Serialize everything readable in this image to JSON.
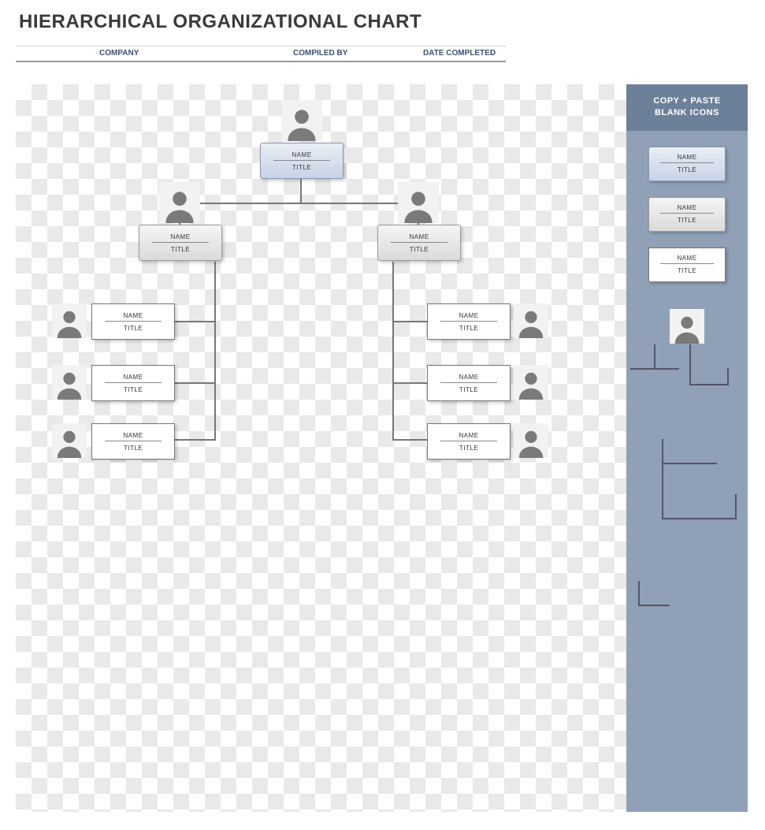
{
  "title": "HIERARCHICAL ORGANIZATIONAL CHART",
  "header": {
    "company": "COMPANY",
    "compiled_by": "COMPILED BY",
    "date_completed": "DATE COMPLETED"
  },
  "sidebar": {
    "title_line1": "COPY + PASTE",
    "title_line2": "BLANK ICONS",
    "cards": [
      {
        "name": "NAME",
        "title": "TITLE"
      },
      {
        "name": "NAME",
        "title": "TITLE"
      },
      {
        "name": "NAME",
        "title": "TITLE"
      }
    ]
  },
  "nodes": {
    "root": {
      "name": "NAME",
      "title": "TITLE"
    },
    "mgrL": {
      "name": "NAME",
      "title": "TITLE"
    },
    "mgrR": {
      "name": "NAME",
      "title": "TITLE"
    },
    "l1": {
      "name": "NAME",
      "title": "TITLE"
    },
    "l2": {
      "name": "NAME",
      "title": "TITLE"
    },
    "l3": {
      "name": "NAME",
      "title": "TITLE"
    },
    "r1": {
      "name": "NAME",
      "title": "TITLE"
    },
    "r2": {
      "name": "NAME",
      "title": "TITLE"
    },
    "r3": {
      "name": "NAME",
      "title": "TITLE"
    }
  }
}
